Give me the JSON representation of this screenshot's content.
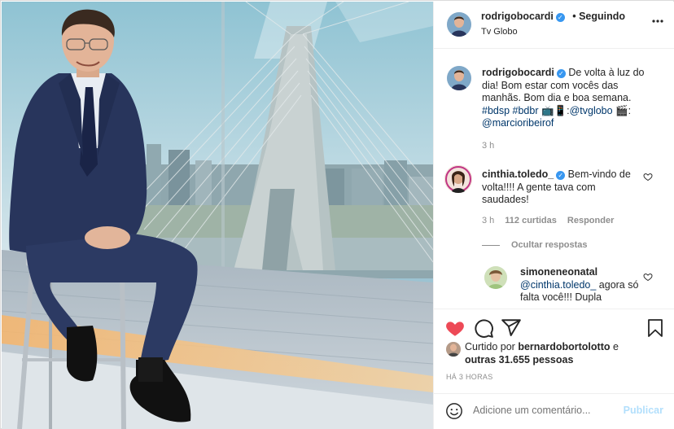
{
  "post": {
    "author": "rodrigobocardi",
    "follow_status": "• Seguindo",
    "location": "Tv Globo"
  },
  "caption": {
    "username": "rodrigobocardi",
    "text_1": " De volta à luz do dia! Bom estar com vocês das manhãs. Bom dia e boa semana. ",
    "hashtags": "#bdsp #bdbr",
    "text_2": " 📺📱:",
    "mention_1": "@tvglobo",
    "text_3": " 🎬:",
    "mention_2": "@marcioribeirof",
    "time": "3 h"
  },
  "comments": [
    {
      "username": "cinthia.toledo_",
      "text": " Bem-vindo de volta!!!! A gente tava com saudades!",
      "time": "3 h",
      "likes": "112 curtidas",
      "reply": "Responder",
      "hide_replies": "Ocultar respostas"
    }
  ],
  "reply": {
    "username": "simoneneonatal",
    "mention": "@cinthia.toledo_",
    "text": " agora só falta você!!! Dupla"
  },
  "actions": {
    "liked_prefix": "Curtido por ",
    "liked_user": "bernardobortolotto",
    "liked_mid": " e",
    "liked_others": "outras 31.655 pessoas",
    "timestamp": "HÁ 3 HORAS"
  },
  "add_comment": {
    "placeholder": "Adicione um comentário...",
    "publish": "Publicar"
  },
  "colors": {
    "like_red": "#ed4956",
    "verified_blue": "#3897f0",
    "link_blue": "#00376b",
    "publish_disabled": "#b2dffc"
  }
}
